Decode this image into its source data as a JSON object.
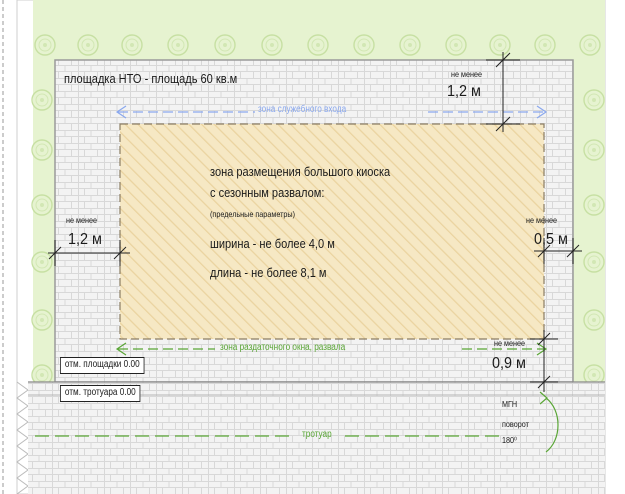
{
  "site_label": "площадка НТО - площадь 60 кв.м",
  "service_zone_label": "зона служебного входа",
  "kiosk": {
    "title_line1": "зона размещения большого киоска",
    "title_line2": "с сезонным развалом:",
    "subtitle": "(предельные параметры)",
    "width": "ширина - не более 4,0 м",
    "length": "длина - не более 8,1 м"
  },
  "serving_zone_label": "зона раздаточного окна, развала",
  "sidewalk_label": "тротуар",
  "elevations": {
    "site": "отм. площадки 0.00",
    "sidewalk": "отм. тротуара 0.00"
  },
  "dimensions": [
    {
      "prefix": "не менее",
      "value": "1,2 м"
    },
    {
      "prefix": "не менее",
      "value": "1,2 м"
    },
    {
      "prefix": "не менее",
      "value": "0,5 м"
    },
    {
      "prefix": "не менее",
      "value": "0,9 м"
    }
  ],
  "mgn": {
    "line1": "МГН",
    "line2": "поворот",
    "line3": "180⁰"
  },
  "colors": {
    "grass": "#e5f2cf",
    "paving": "#f2f2f2",
    "kiosk_fill": "#f6e8c4",
    "kiosk_hatch": "#e8cfa0",
    "service_zone": "#8aa8ee",
    "serving_zone": "#5aa636",
    "tree_outline": "#c9e2a6"
  }
}
